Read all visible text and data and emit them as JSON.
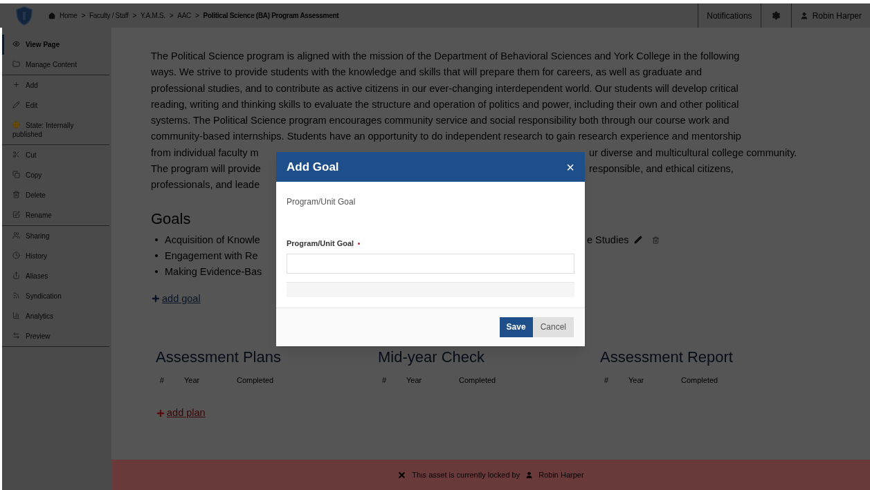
{
  "header": {
    "breadcrumb": [
      {
        "label": "Home",
        "current": false
      },
      {
        "label": "Faculty / Staff",
        "current": false
      },
      {
        "label": "Y.A.M.S.",
        "current": false
      },
      {
        "label": "AAC",
        "current": false
      },
      {
        "label": "Political Science (BA) Program Assessment",
        "current": true
      }
    ],
    "separator": ">",
    "notifications": "Notifications",
    "user": "Robin Harper"
  },
  "sidebar": {
    "groups": [
      [
        {
          "label": "View Page",
          "selected": true
        },
        {
          "label": "Manage Content",
          "selected": false
        }
      ],
      [
        {
          "label": "Add",
          "selected": false
        },
        {
          "label": "Edit",
          "selected": false
        },
        {
          "label": "State: Internally published",
          "selected": false
        }
      ],
      [
        {
          "label": "Cut",
          "selected": false
        },
        {
          "label": "Copy",
          "selected": false
        },
        {
          "label": "Delete",
          "selected": false
        },
        {
          "label": "Rename",
          "selected": false
        }
      ],
      [
        {
          "label": "Sharing",
          "selected": false
        },
        {
          "label": "History",
          "selected": false
        },
        {
          "label": "Aliases",
          "selected": false
        },
        {
          "label": "Syndication",
          "selected": false
        },
        {
          "label": "Analytics",
          "selected": false
        },
        {
          "label": "Preview",
          "selected": false
        }
      ]
    ]
  },
  "mission": {
    "lines": [
      [
        "The Political Science program is aligned with the mission of the Department of Behavioral Sciences and York College in the following"
      ],
      [
        "ways. We strive to provide students with the knowledge and skills that will prepare them for careers, as well as graduate and"
      ],
      [
        "professional studies, and to contribute as active citizens in our ever-changing interdependent world. Our students will develop critical"
      ],
      [
        "reading, writing and thinking skills to evaluate the structure and operation of politics and power, including their own and other political"
      ],
      [
        "systems. The Political Science program encourages community service and social responsibility both through our course work and"
      ],
      [
        "community-based internships. Students have an opportunity to do independent research to gain research experience and mentorship"
      ],
      [
        "from individual faculty m",
        "ur diverse and multicultural college community."
      ],
      [
        "The program will provide",
        "responsible, and ethical citizens,"
      ],
      [
        "professionals, and leade"
      ]
    ]
  },
  "goals": {
    "title": "Goals",
    "items": [
      [
        "Acquisition of Knowle",
        "e Studies"
      ],
      [
        "Engagement with Re"
      ],
      [
        "Making Evidence-Bas"
      ]
    ],
    "add_link": "add goal"
  },
  "sections": [
    {
      "title": "Assessment Plans",
      "columns": [
        "#",
        "Year",
        "Completed"
      ],
      "add_link": "add plan"
    },
    {
      "title": "Mid-year Check",
      "columns": [
        "#",
        "Year",
        "Completed"
      ]
    },
    {
      "title": "Assessment Report",
      "columns": [
        "#",
        "Year",
        "Completed"
      ]
    }
  ],
  "modal": {
    "title": "Add Goal",
    "close": "×",
    "subtitle": "Program/Unit Goal",
    "field": {
      "label": "Program/Unit Goal",
      "required": true
    },
    "buttons": [
      {
        "label": "Save",
        "kind": "primary"
      },
      {
        "label": "Cancel",
        "kind": "secondary"
      }
    ]
  },
  "lock_bar": {
    "text": "This asset is currently locked by",
    "user": "Robin Harper"
  }
}
